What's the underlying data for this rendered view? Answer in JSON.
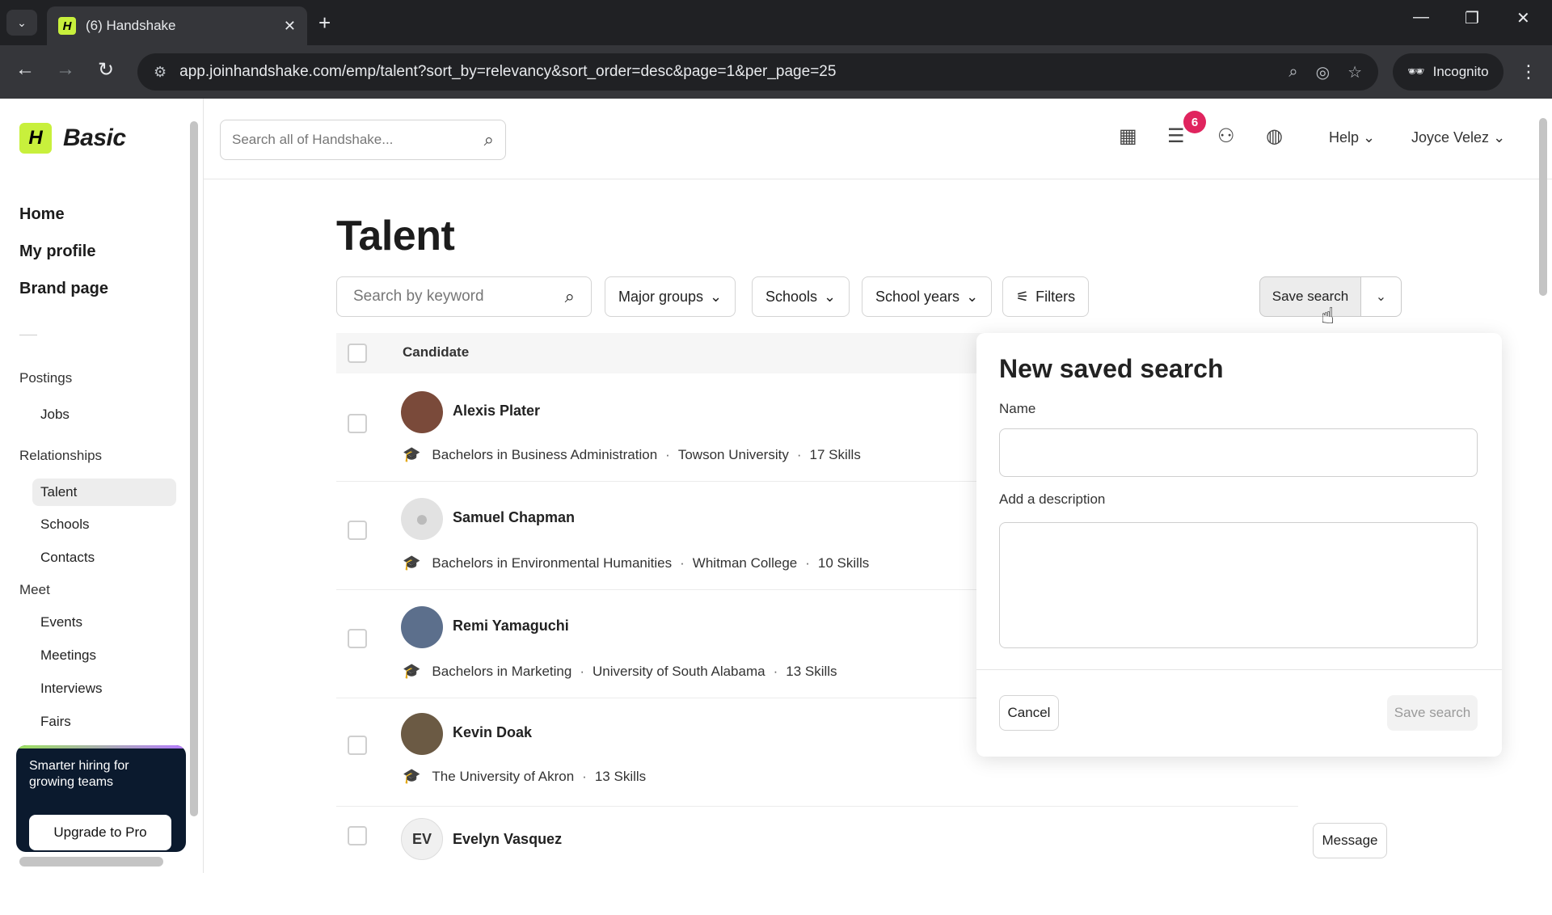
{
  "browser": {
    "tab_title": "(6) Handshake",
    "favicon_letter": "H",
    "url": "app.joinhandshake.com/emp/talent?sort_by=relevancy&sort_order=desc&page=1&per_page=25",
    "incognito_label": "Incognito"
  },
  "sidebar": {
    "brand_letter": "H",
    "brand_tier": "Basic",
    "main_items": [
      "Home",
      "My profile",
      "Brand page"
    ],
    "sections": {
      "postings": {
        "label": "Postings",
        "items": [
          "Jobs"
        ]
      },
      "relationships": {
        "label": "Relationships",
        "items": [
          "Talent",
          "Schools",
          "Contacts"
        ]
      },
      "meet": {
        "label": "Meet",
        "items": [
          "Events",
          "Meetings",
          "Interviews",
          "Fairs"
        ]
      }
    },
    "active_item": "Talent",
    "promo": {
      "text": "Smarter hiring for growing teams",
      "button": "Upgrade to Pro"
    }
  },
  "header": {
    "search_placeholder": "Search all of Handshake...",
    "notification_count": "6",
    "help_label": "Help",
    "user_name": "Joyce Velez"
  },
  "main": {
    "title": "Talent",
    "keyword_placeholder": "Search by keyword",
    "filters": [
      "Major groups",
      "Schools",
      "School years"
    ],
    "filters_button": "Filters",
    "save_search_button": "Save search",
    "table_header": "Candidate",
    "candidates": [
      {
        "name": "Alexis Plater",
        "degree": "Bachelors in Business Administration",
        "school": "Towson University",
        "skills": "17 Skills",
        "initials": ""
      },
      {
        "name": "Samuel Chapman",
        "degree": "Bachelors in Environmental Humanities",
        "school": "Whitman College",
        "skills": "10 Skills",
        "initials": ""
      },
      {
        "name": "Remi Yamaguchi",
        "degree": "Bachelors in Marketing",
        "school": "University of South Alabama",
        "skills": "13 Skills",
        "initials": ""
      },
      {
        "name": "Kevin Doak",
        "degree": "",
        "school": "The University of Akron",
        "skills": "13 Skills",
        "initials": ""
      },
      {
        "name": "Evelyn Vasquez",
        "degree": "",
        "school": "",
        "skills": "",
        "initials": "EV"
      }
    ],
    "message_button": "Message"
  },
  "popover": {
    "title": "New saved search",
    "name_label": "Name",
    "name_value": "",
    "description_label": "Add a description",
    "description_value": "",
    "cancel_button": "Cancel",
    "save_button": "Save search"
  },
  "colors": {
    "brand_lime": "#c8f03c",
    "badge": "#e0245e",
    "promo_bg": "#0b1a2e"
  }
}
